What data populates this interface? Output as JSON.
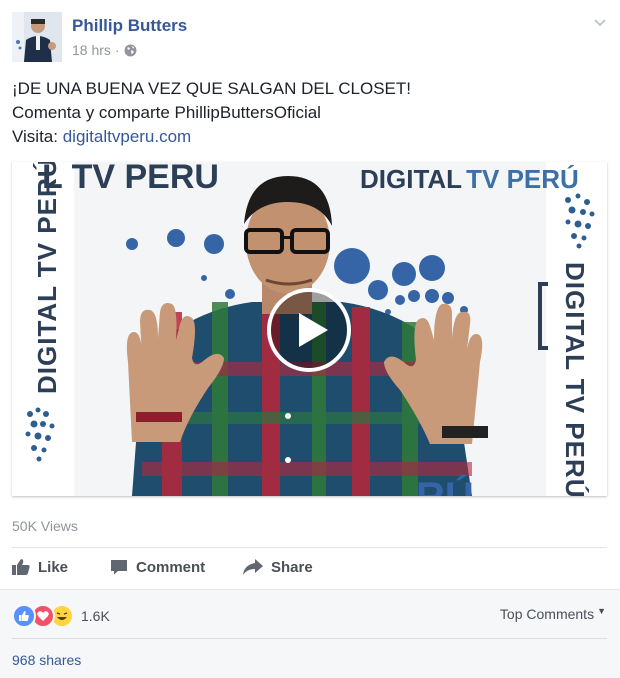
{
  "header": {
    "author": "Phillip Butters",
    "time": "18 hrs",
    "separator": "·"
  },
  "post": {
    "line1": "¡DE UNA BUENA VEZ QUE SALGAN DEL CLOSET!",
    "line2": "Comenta y comparte PhillipButtersOficial",
    "visit_label": "Visita: ",
    "visit_link": "digitaltvperu.com"
  },
  "video": {
    "brand_top": "DIGITAL",
    "brand_top_accent": "TV PERÚ",
    "brand_partial": "L TV PERU",
    "brand_left": "DIGITAL TV PERÚ",
    "brand_right": "DIGITAL TV PERÚ"
  },
  "stats": {
    "views": "50K Views"
  },
  "actions": {
    "like": "Like",
    "comment": "Comment",
    "share": "Share"
  },
  "reactions": {
    "count": "1.6K",
    "top_comments": "Top Comments",
    "shares": "968 shares"
  },
  "colors": {
    "link": "#365899",
    "brand_dark": "#2d3f57",
    "brand_accent": "#3d6fa8"
  }
}
